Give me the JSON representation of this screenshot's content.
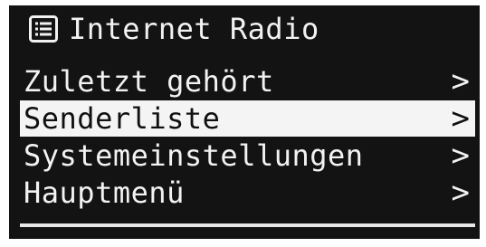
{
  "header": {
    "title": "Internet Radio",
    "icon": "list-icon"
  },
  "menu": {
    "items": [
      {
        "label": "Zuletzt gehört",
        "arrow": ">",
        "selected": false
      },
      {
        "label": "Senderliste",
        "arrow": ">",
        "selected": true
      },
      {
        "label": "Systemeinstellungen",
        "arrow": ">",
        "selected": false
      },
      {
        "label": "Hauptmenü",
        "arrow": ">",
        "selected": false
      }
    ]
  },
  "colors": {
    "screen_background": "#131313",
    "text": "#f2f2f2",
    "highlight_background": "#f4f4f4",
    "highlight_text": "#101010"
  }
}
